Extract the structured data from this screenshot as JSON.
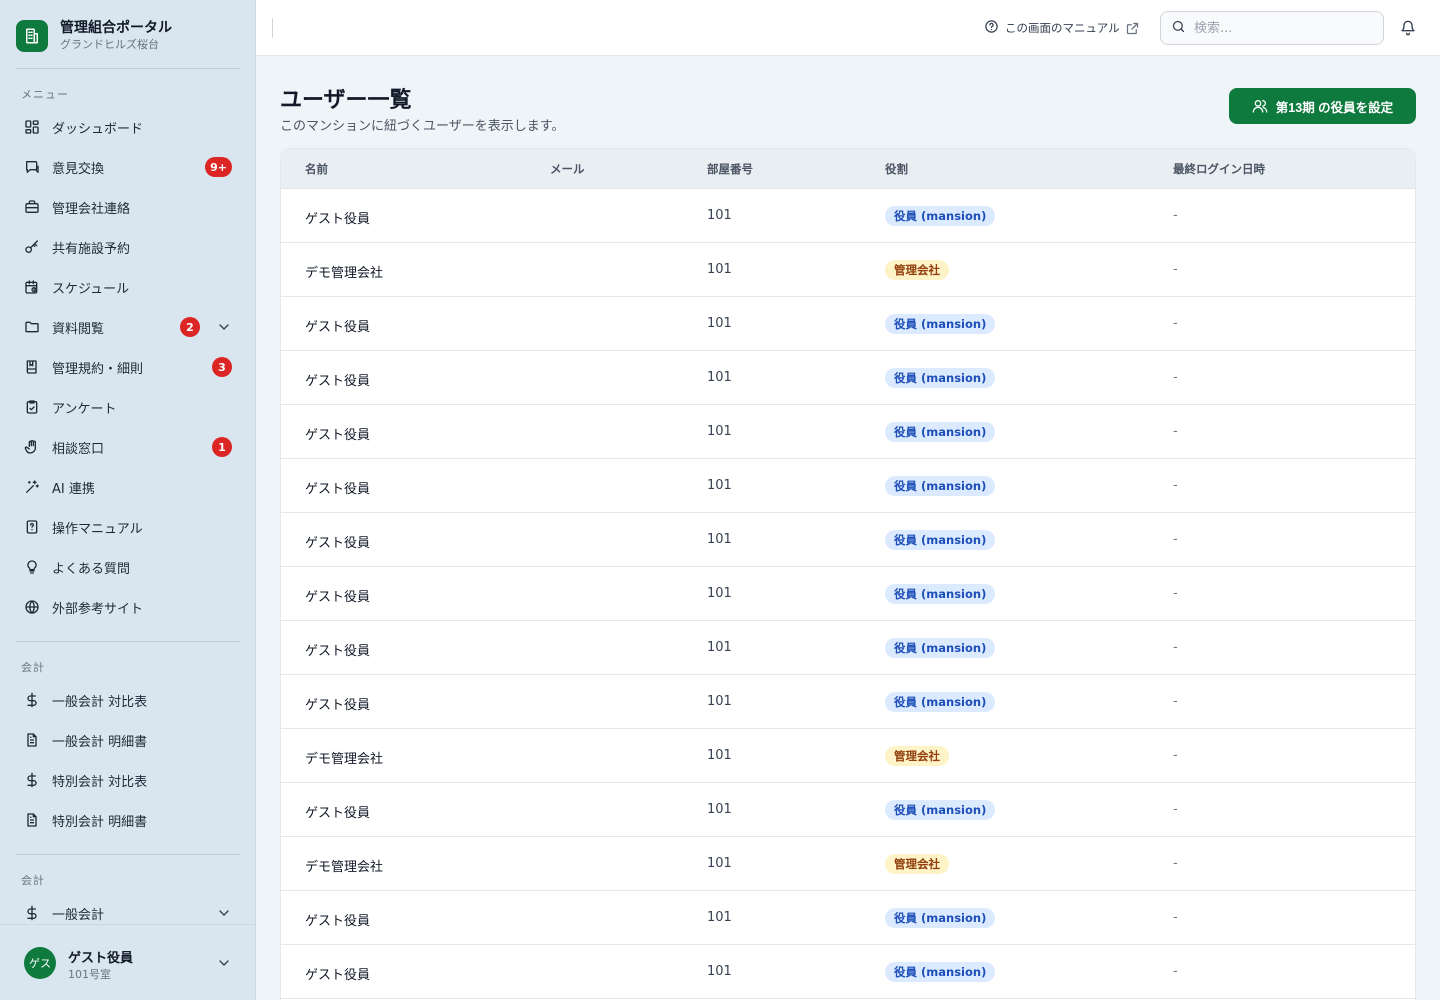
{
  "brand": {
    "title": "管理組合ポータル",
    "subtitle": "グランドヒルズ桜台"
  },
  "sidebar": {
    "menu_label": "メニュー",
    "items": [
      {
        "label": "ダッシュボード"
      },
      {
        "label": "意見交換",
        "badge": "9+"
      },
      {
        "label": "管理会社連絡"
      },
      {
        "label": "共有施設予約"
      },
      {
        "label": "スケジュール"
      },
      {
        "label": "資料閲覧",
        "badge": "2"
      },
      {
        "label": "管理規約・細則",
        "badge": "3"
      },
      {
        "label": "アンケート"
      },
      {
        "label": "相談窓口",
        "badge": "1"
      },
      {
        "label": "AI 連携"
      },
      {
        "label": "操作マニュアル"
      },
      {
        "label": "よくある質問"
      },
      {
        "label": "外部参考サイト"
      }
    ],
    "accounting_label": "会計",
    "accounting_items": [
      {
        "label": "一般会計 対比表"
      },
      {
        "label": "一般会計 明細書"
      },
      {
        "label": "特別会計 対比表"
      },
      {
        "label": "特別会計 明細書"
      }
    ],
    "accounting2_label": "会計",
    "accounting2_items": [
      {
        "label": "一般会計"
      }
    ]
  },
  "user": {
    "avatar": "ゲス",
    "name": "ゲスト役員",
    "room": "101号室"
  },
  "header": {
    "manual_link": "この画面のマニュアル",
    "search_placeholder": "検索..."
  },
  "page": {
    "title": "ユーザー一覧",
    "subtitle": "このマンションに紐づくユーザーを表示します。",
    "action_button": "第13期 の役員を設定"
  },
  "table": {
    "columns": {
      "name": "名前",
      "email": "メール",
      "room": "部屋番号",
      "role": "役割",
      "last_login": "最終ログイン日時"
    },
    "rows": [
      {
        "name": "ゲスト役員",
        "email": "",
        "room": "101",
        "role": "役員 (mansion)",
        "role_type": "officer",
        "last_login": "-"
      },
      {
        "name": "デモ管理会社",
        "email": "",
        "room": "101",
        "role": "管理会社",
        "role_type": "mgmt",
        "last_login": "-"
      },
      {
        "name": "ゲスト役員",
        "email": "",
        "room": "101",
        "role": "役員 (mansion)",
        "role_type": "officer",
        "last_login": "-"
      },
      {
        "name": "ゲスト役員",
        "email": "",
        "room": "101",
        "role": "役員 (mansion)",
        "role_type": "officer",
        "last_login": "-"
      },
      {
        "name": "ゲスト役員",
        "email": "",
        "room": "101",
        "role": "役員 (mansion)",
        "role_type": "officer",
        "last_login": "-"
      },
      {
        "name": "ゲスト役員",
        "email": "",
        "room": "101",
        "role": "役員 (mansion)",
        "role_type": "officer",
        "last_login": "-"
      },
      {
        "name": "ゲスト役員",
        "email": "",
        "room": "101",
        "role": "役員 (mansion)",
        "role_type": "officer",
        "last_login": "-"
      },
      {
        "name": "ゲスト役員",
        "email": "",
        "room": "101",
        "role": "役員 (mansion)",
        "role_type": "officer",
        "last_login": "-"
      },
      {
        "name": "ゲスト役員",
        "email": "",
        "room": "101",
        "role": "役員 (mansion)",
        "role_type": "officer",
        "last_login": "-"
      },
      {
        "name": "ゲスト役員",
        "email": "",
        "room": "101",
        "role": "役員 (mansion)",
        "role_type": "officer",
        "last_login": "-"
      },
      {
        "name": "デモ管理会社",
        "email": "",
        "room": "101",
        "role": "管理会社",
        "role_type": "mgmt",
        "last_login": "-"
      },
      {
        "name": "ゲスト役員",
        "email": "",
        "room": "101",
        "role": "役員 (mansion)",
        "role_type": "officer",
        "last_login": "-"
      },
      {
        "name": "デモ管理会社",
        "email": "",
        "room": "101",
        "role": "管理会社",
        "role_type": "mgmt",
        "last_login": "-"
      },
      {
        "name": "ゲスト役員",
        "email": "",
        "room": "101",
        "role": "役員 (mansion)",
        "role_type": "officer",
        "last_login": "-"
      },
      {
        "name": "ゲスト役員",
        "email": "",
        "room": "101",
        "role": "役員 (mansion)",
        "role_type": "officer",
        "last_login": "-"
      }
    ]
  },
  "colors": {
    "accent": "#0f7a3d",
    "badge": "#dc2626",
    "sidebar_bg": "#d9e6ef",
    "officer_tag": "#dbeafe",
    "mgmt_tag": "#fef3c7"
  }
}
